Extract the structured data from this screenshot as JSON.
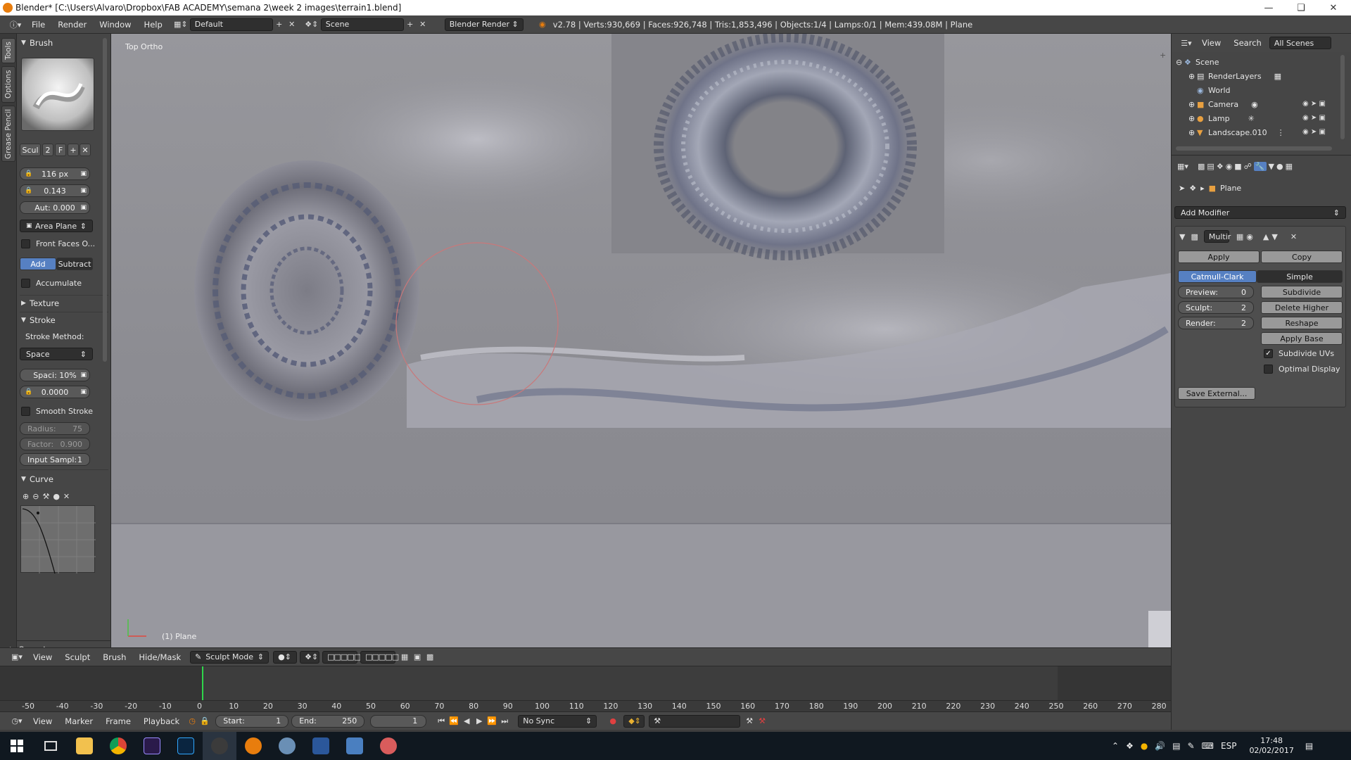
{
  "window": {
    "title": "Blender* [C:\\Users\\Alvaro\\Dropbox\\FAB ACADEMY\\semana 2\\week 2 images\\terrain1.blend]"
  },
  "info_header": {
    "menus": [
      "File",
      "Render",
      "Window",
      "Help"
    ],
    "layout": "Default",
    "scene": "Scene",
    "engine": "Blender Render",
    "stats": "v2.78 | Verts:930,669 | Faces:926,748 | Tris:1,853,496 | Objects:1/4 | Lamps:0/1 | Mem:439.08M | Plane"
  },
  "tabs": [
    "Tools",
    "Options",
    "Grease Pencil"
  ],
  "toolshelf": {
    "brush_header": "Brush",
    "brush_name": "Scul",
    "brush_users": "2",
    "brush_fake": "F",
    "radius": "116 px",
    "strength": "0.143",
    "autosmooth": "Aut: 0.000",
    "plane": "Area Plane",
    "front_faces": "Front Faces O...",
    "add": "Add",
    "subtract": "Subtract",
    "accumulate": "Accumulate",
    "texture_header": "Texture",
    "stroke_header": "Stroke",
    "stroke_method_label": "Stroke Method:",
    "stroke_method": "Space",
    "spacing": "Spaci: 10%",
    "jitter": "0.0000",
    "smooth_stroke": "Smooth Stroke",
    "smooth_radius_label": "Radius:",
    "smooth_radius_value": "75",
    "smooth_factor_label": "Factor:",
    "smooth_factor_value": "0.900",
    "input_samples_label": "Input Sampl:",
    "input_samples_value": "1",
    "curve_header": "Curve",
    "operator_header": "Operator"
  },
  "viewport": {
    "view_label": "Top Ortho",
    "object_label": "(1) Plane"
  },
  "view3d_header": {
    "menus": [
      "View",
      "Sculpt",
      "Brush",
      "Hide/Mask"
    ],
    "mode": "Sculpt Mode"
  },
  "timeline": {
    "ticks": [
      "-50",
      "-40",
      "-30",
      "-20",
      "-10",
      "0",
      "10",
      "20",
      "30",
      "40",
      "50",
      "60",
      "70",
      "80",
      "90",
      "100",
      "110",
      "120",
      "130",
      "140",
      "150",
      "160",
      "170",
      "180",
      "190",
      "200",
      "210",
      "220",
      "230",
      "240",
      "250",
      "260",
      "270",
      "280"
    ],
    "menus": [
      "View",
      "Marker",
      "Frame",
      "Playback"
    ],
    "start_label": "Start:",
    "start_value": "1",
    "end_label": "End:",
    "end_value": "250",
    "current_frame": "1",
    "sync": "No Sync"
  },
  "outliner": {
    "menus": [
      "View",
      "Search"
    ],
    "scenes": "All Scenes",
    "items": [
      "Scene",
      "RenderLayers",
      "World",
      "Camera",
      "Lamp",
      "Landscape.010"
    ]
  },
  "properties": {
    "object": "Plane",
    "add_modifier": "Add Modifier",
    "modifier_name": "Multir",
    "apply": "Apply",
    "copy": "Copy",
    "catmull": "Catmull-Clark",
    "simple": "Simple",
    "preview_label": "Preview:",
    "preview_value": "0",
    "sculpt_label": "Sculpt:",
    "sculpt_value": "2",
    "render_label": "Render:",
    "render_value": "2",
    "subdivide": "Subdivide",
    "delete_higher": "Delete Higher",
    "reshape": "Reshape",
    "apply_base": "Apply Base",
    "subdivide_uvs": "Subdivide UVs",
    "optimal_display": "Optimal Display",
    "save_external": "Save External..."
  },
  "taskbar": {
    "lang": "ESP",
    "time": "17:48",
    "date": "02/02/2017"
  },
  "colors": {
    "accent": "#5680c2",
    "timeline_cursor": "#2fd64b",
    "brush_circle": "#c9787a"
  }
}
